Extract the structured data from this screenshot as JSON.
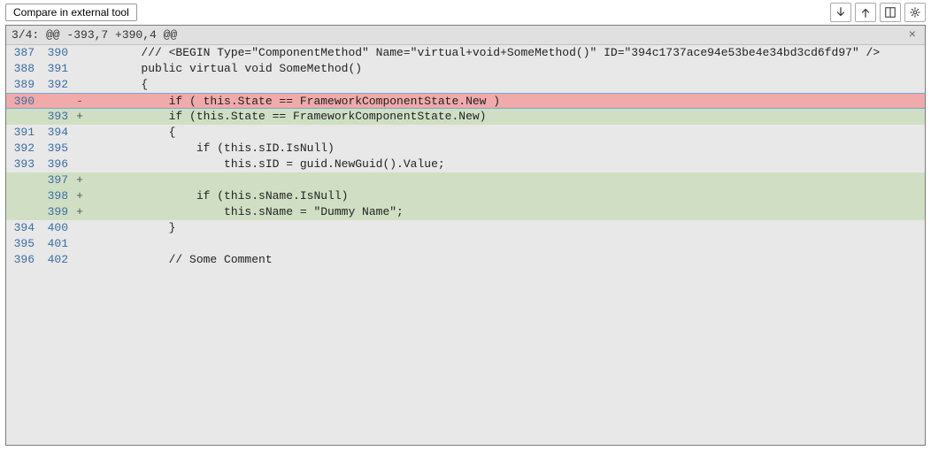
{
  "toolbar": {
    "compare_label": "Compare in external tool",
    "icons": {
      "down": "arrow-down-icon",
      "up": "arrow-up-icon",
      "sidebyside": "side-by-side-icon",
      "settings": "settings-icon"
    }
  },
  "hunk": {
    "header": "3/4: @@ -393,7 +390,4 @@",
    "close": "×"
  },
  "lines": [
    {
      "a": "387",
      "b": "390",
      "m": " ",
      "t": "ctx",
      "code": "        /// <BEGIN Type=\"ComponentMethod\" Name=\"virtual+void+SomeMethod()\" ID=\"394c1737ace94e53be4e34bd3cd6fd97\" />"
    },
    {
      "a": "388",
      "b": "391",
      "m": " ",
      "t": "ctx",
      "code": "        public virtual void SomeMethod()"
    },
    {
      "a": "389",
      "b": "392",
      "m": " ",
      "t": "ctx",
      "code": "        {"
    },
    {
      "a": "390",
      "b": "",
      "m": "-",
      "t": "del",
      "code": "            if ( this.State == FrameworkComponentState.New )"
    },
    {
      "a": "",
      "b": "393",
      "m": "+",
      "t": "add",
      "code": "            if (this.State == FrameworkComponentState.New)"
    },
    {
      "a": "391",
      "b": "394",
      "m": " ",
      "t": "ctx",
      "code": "            {"
    },
    {
      "a": "392",
      "b": "395",
      "m": " ",
      "t": "ctx",
      "code": "                if (this.sID.IsNull)"
    },
    {
      "a": "393",
      "b": "396",
      "m": " ",
      "t": "ctx",
      "code": "                    this.sID = guid.NewGuid().Value;"
    },
    {
      "a": "",
      "b": "397",
      "m": "+",
      "t": "add",
      "code": ""
    },
    {
      "a": "",
      "b": "398",
      "m": "+",
      "t": "add",
      "code": "                if (this.sName.IsNull)"
    },
    {
      "a": "",
      "b": "399",
      "m": "+",
      "t": "add",
      "code": "                    this.sName = \"Dummy Name\";"
    },
    {
      "a": "394",
      "b": "400",
      "m": " ",
      "t": "ctx",
      "code": "            }"
    },
    {
      "a": "395",
      "b": "401",
      "m": " ",
      "t": "ctx",
      "code": ""
    },
    {
      "a": "396",
      "b": "402",
      "m": " ",
      "t": "ctx",
      "code": "            // Some Comment"
    }
  ]
}
